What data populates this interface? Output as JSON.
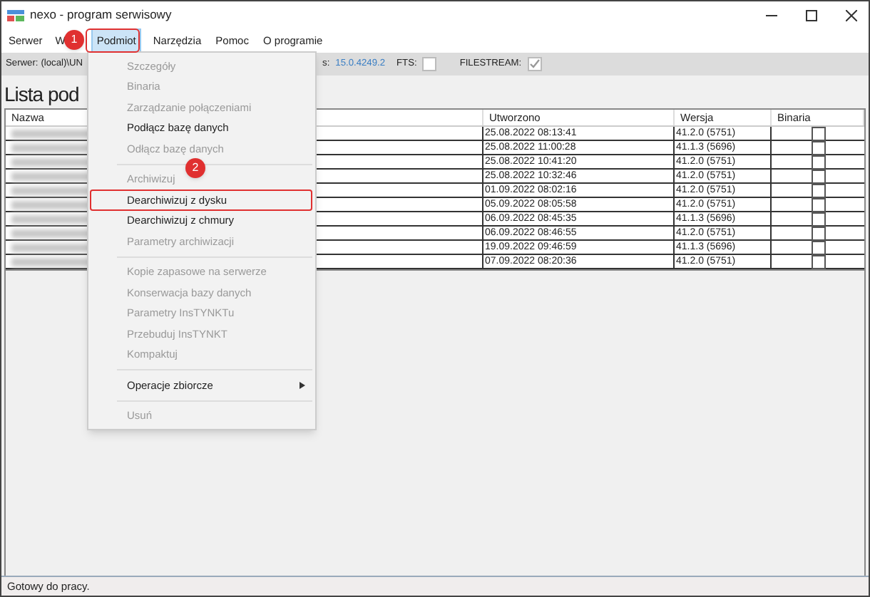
{
  "window": {
    "title": "nexo - program serwisowy"
  },
  "menu_bar": [
    {
      "label": "Serwer",
      "selected": false
    },
    {
      "label": "W",
      "selected": false
    },
    {
      "label": "Podmiot",
      "selected": true
    },
    {
      "label": "Narzędzia",
      "selected": false
    },
    {
      "label": "Pomoc",
      "selected": false
    },
    {
      "label": "O programie",
      "selected": false
    }
  ],
  "info_bar": {
    "server_label": "Serwer:",
    "server_value": "(local)\\UN",
    "version_label": "s:",
    "version_value": "15.0.4249.2",
    "fts_label": "FTS:",
    "fts_checked": false,
    "filestream_label": "FILESTREAM:",
    "filestream_checked": true
  },
  "heading": "Lista pod",
  "table": {
    "columns": [
      "Nazwa",
      "Utworzono",
      "Wersja",
      "Binaria"
    ],
    "rows": [
      {
        "created": "25.08.2022 08:13:41",
        "version": "41.2.0 (5751)",
        "binaria": false
      },
      {
        "created": "25.08.2022 11:00:28",
        "version": "41.1.3 (5696)",
        "binaria": false
      },
      {
        "created": "25.08.2022 10:41:20",
        "version": "41.2.0 (5751)",
        "binaria": false
      },
      {
        "created": "25.08.2022 10:32:46",
        "version": "41.2.0 (5751)",
        "binaria": false
      },
      {
        "created": "01.09.2022 08:02:16",
        "version": "41.2.0 (5751)",
        "binaria": false
      },
      {
        "created": "05.09.2022 08:05:58",
        "version": "41.2.0 (5751)",
        "binaria": false
      },
      {
        "created": "06.09.2022 08:45:35",
        "version": "41.1.3 (5696)",
        "binaria": false
      },
      {
        "created": "06.09.2022 08:46:55",
        "version": "41.2.0 (5751)",
        "binaria": false
      },
      {
        "created": "19.09.2022 09:46:59",
        "version": "41.1.3 (5696)",
        "binaria": false
      },
      {
        "created": "07.09.2022 08:20:36",
        "version": "41.2.0 (5751)",
        "binaria": false
      }
    ]
  },
  "dropdown_menu": [
    {
      "kind": "item",
      "label": "Szczegóły",
      "disabled": true,
      "highlighted": false
    },
    {
      "kind": "item",
      "label": "Binaria",
      "disabled": true,
      "highlighted": false
    },
    {
      "kind": "item",
      "label": "Zarządzanie połączeniami",
      "disabled": true,
      "highlighted": false
    },
    {
      "kind": "item",
      "label": "Podłącz bazę danych",
      "disabled": false,
      "highlighted": false
    },
    {
      "kind": "item",
      "label": "Odłącz bazę danych",
      "disabled": true,
      "highlighted": false
    },
    {
      "kind": "separator"
    },
    {
      "kind": "item",
      "label": "Archiwizuj",
      "disabled": true,
      "highlighted": false
    },
    {
      "kind": "item",
      "label": "Dearchiwizuj z dysku",
      "disabled": false,
      "highlighted": true
    },
    {
      "kind": "item",
      "label": "Dearchiwizuj z chmury",
      "disabled": false,
      "highlighted": false
    },
    {
      "kind": "item",
      "label": "Parametry archiwizacji",
      "disabled": true,
      "highlighted": false
    },
    {
      "kind": "separator"
    },
    {
      "kind": "item",
      "label": "Kopie zapasowe na serwerze",
      "disabled": true,
      "highlighted": false
    },
    {
      "kind": "item",
      "label": "Konserwacja bazy danych",
      "disabled": true,
      "highlighted": false
    },
    {
      "kind": "item",
      "label": "Parametry InsTYNKTu",
      "disabled": true,
      "highlighted": false
    },
    {
      "kind": "item",
      "label": "Przebuduj InsTYNKT",
      "disabled": true,
      "highlighted": false
    },
    {
      "kind": "item",
      "label": "Kompaktuj",
      "disabled": true,
      "highlighted": false
    },
    {
      "kind": "separator"
    },
    {
      "kind": "submenu",
      "label": "Operacje zbiorcze",
      "disabled": false,
      "highlighted": false
    },
    {
      "kind": "separator"
    },
    {
      "kind": "item",
      "label": "Usuń",
      "disabled": true,
      "highlighted": false
    }
  ],
  "callouts": [
    "1",
    "2"
  ],
  "status_bar": "Gotowy do pracy."
}
